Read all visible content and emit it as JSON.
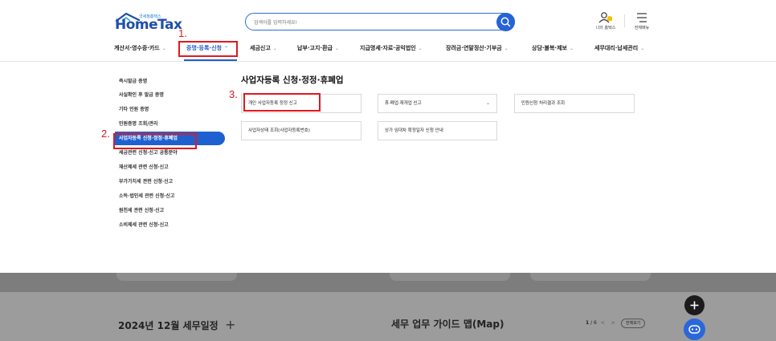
{
  "header": {
    "logo_sub": "국세청홈택스",
    "logo_main": "HomeTax",
    "search_placeholder": "검색어를 입력하세요!",
    "my_home_label": "나의 홈택스",
    "all_menu_label": "전체메뉴"
  },
  "nav": {
    "items": [
      {
        "label": "계산서·영수증·카드"
      },
      {
        "label": "증명·등록·신청"
      },
      {
        "label": "세금신고"
      },
      {
        "label": "납부·고지·환급"
      },
      {
        "label": "지급명세·자료·공익법인"
      },
      {
        "label": "장려금·연말정산·기부금"
      },
      {
        "label": "상담·불복·제보"
      },
      {
        "label": "세무대리·납세관리"
      }
    ],
    "active_index": 1
  },
  "sidebar": {
    "items": [
      {
        "label": "즉시발급 증명"
      },
      {
        "label": "사실확인 후 발급 증명"
      },
      {
        "label": "기타 민원 증명"
      },
      {
        "label": "민원증명 조회/관리"
      },
      {
        "label": "사업자등록 신청·정정·휴폐업"
      },
      {
        "label": "세금관련 신청·신고 공통분야"
      },
      {
        "label": "재산제세 관련 신청·신고"
      },
      {
        "label": "부가가치세 관련 신청·신고"
      },
      {
        "label": "소득·법인세 관련 신청·신고"
      },
      {
        "label": "원천세 관련 신청·신고"
      },
      {
        "label": "소비제세 관련 신청·신고"
      }
    ],
    "active_index": 4
  },
  "content": {
    "title": "사업자등록 신청·정정·휴폐업",
    "cards": [
      {
        "label": "개인 사업자등록 정정 신고"
      },
      {
        "label": "휴·폐업·재개업 신고"
      },
      {
        "label": "민원신청 처리결과 조회"
      },
      {
        "label": "사업자상태 조회(사업자등록번호)"
      },
      {
        "label": "상가 임대차 확정일자 신청 안내"
      }
    ]
  },
  "annotations": {
    "step1": "1.",
    "step2": "2.",
    "step3": "3."
  },
  "bottom": {
    "schedule_title": "2024년 12월 세무일정",
    "schedule_plus": "+",
    "guide_title": "세무 업무 가이드 맵(Map)",
    "pager_current": "1",
    "pager_total": "/ 6",
    "prev": "<",
    "next": ">",
    "view_all": "전체보기"
  },
  "icons": {
    "search": "search-icon",
    "my_home": "user-bell-icon",
    "all_menu": "hamburger-icon",
    "chevron": "chevron-down-icon",
    "fab_plus": "plus-icon",
    "fab_chat": "chatbot-icon"
  },
  "colors": {
    "primary": "#1f60d1",
    "annotation": "#e0191f",
    "logo": "#1f4fa8"
  }
}
